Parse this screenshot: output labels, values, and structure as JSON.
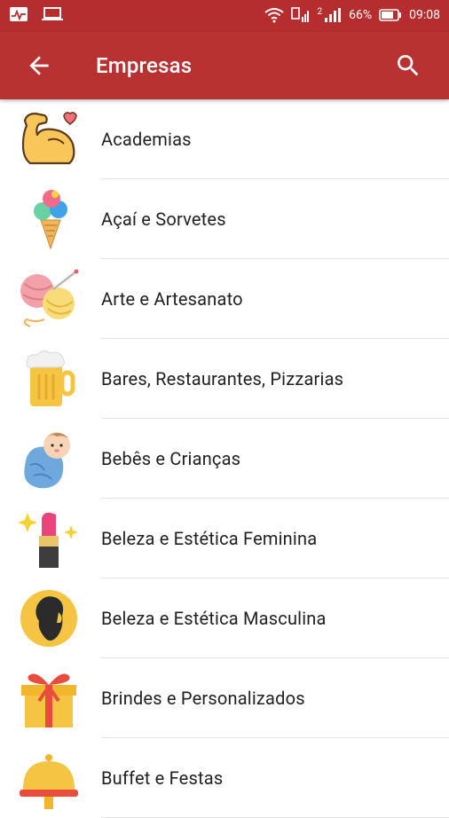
{
  "statusbar": {
    "battery_percent": "66%",
    "time": "09:08",
    "network": "2"
  },
  "appbar": {
    "title": "Empresas",
    "back_icon": "arrow-back-icon",
    "search_icon": "search-icon"
  },
  "categories": [
    {
      "label": "Academias",
      "icon": "flexed-arm-icon"
    },
    {
      "label": "Açaí e Sorvetes",
      "icon": "ice-cream-icon"
    },
    {
      "label": "Arte e Artesanato",
      "icon": "yarn-ball-icon"
    },
    {
      "label": "Bares, Restaurantes, Pizzarias",
      "icon": "beer-mug-icon"
    },
    {
      "label": "Bebês e Crianças",
      "icon": "baby-icon"
    },
    {
      "label": "Beleza e Estética Feminina",
      "icon": "lipstick-icon"
    },
    {
      "label": "Beleza e Estética Masculina",
      "icon": "bearded-man-icon"
    },
    {
      "label": "Brindes e Personalizados",
      "icon": "gift-box-icon"
    },
    {
      "label": "Buffet e Festas",
      "icon": "food-cloche-icon"
    }
  ],
  "colors": {
    "appbar": "#b83232",
    "statusbar": "#b52d2e",
    "divider": "#e3e3e3",
    "text": "#212121"
  }
}
